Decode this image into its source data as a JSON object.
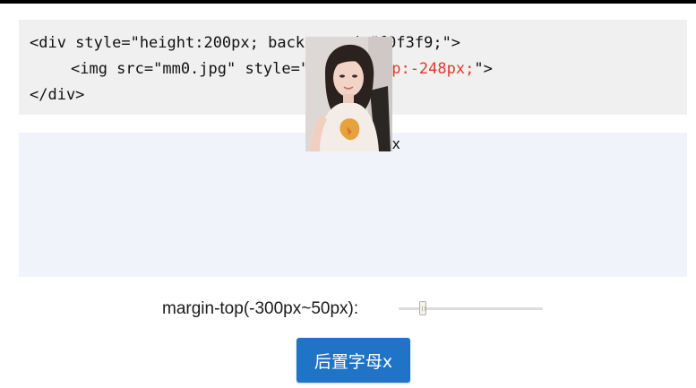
{
  "code": {
    "line1": "<div style=\"height:200px; background:#f0f3f9;\">",
    "line2_prefix": "<img src=\"mm0.jpg\" style=\"",
    "line2_highlight": "margin-top:-248px;",
    "line2_suffix": "\">",
    "line3": "</div>"
  },
  "demo": {
    "trailing_text": "x",
    "image_alt": "photo"
  },
  "controls": {
    "label": "margin-top(-300px~50px):",
    "slider_min": -300,
    "slider_max": 50,
    "slider_value": -248
  },
  "button": {
    "label": "后置字母x"
  },
  "colors": {
    "accent": "#1f74c8",
    "code_highlight": "#e0392b",
    "demo_background": "#f0f3f9"
  }
}
